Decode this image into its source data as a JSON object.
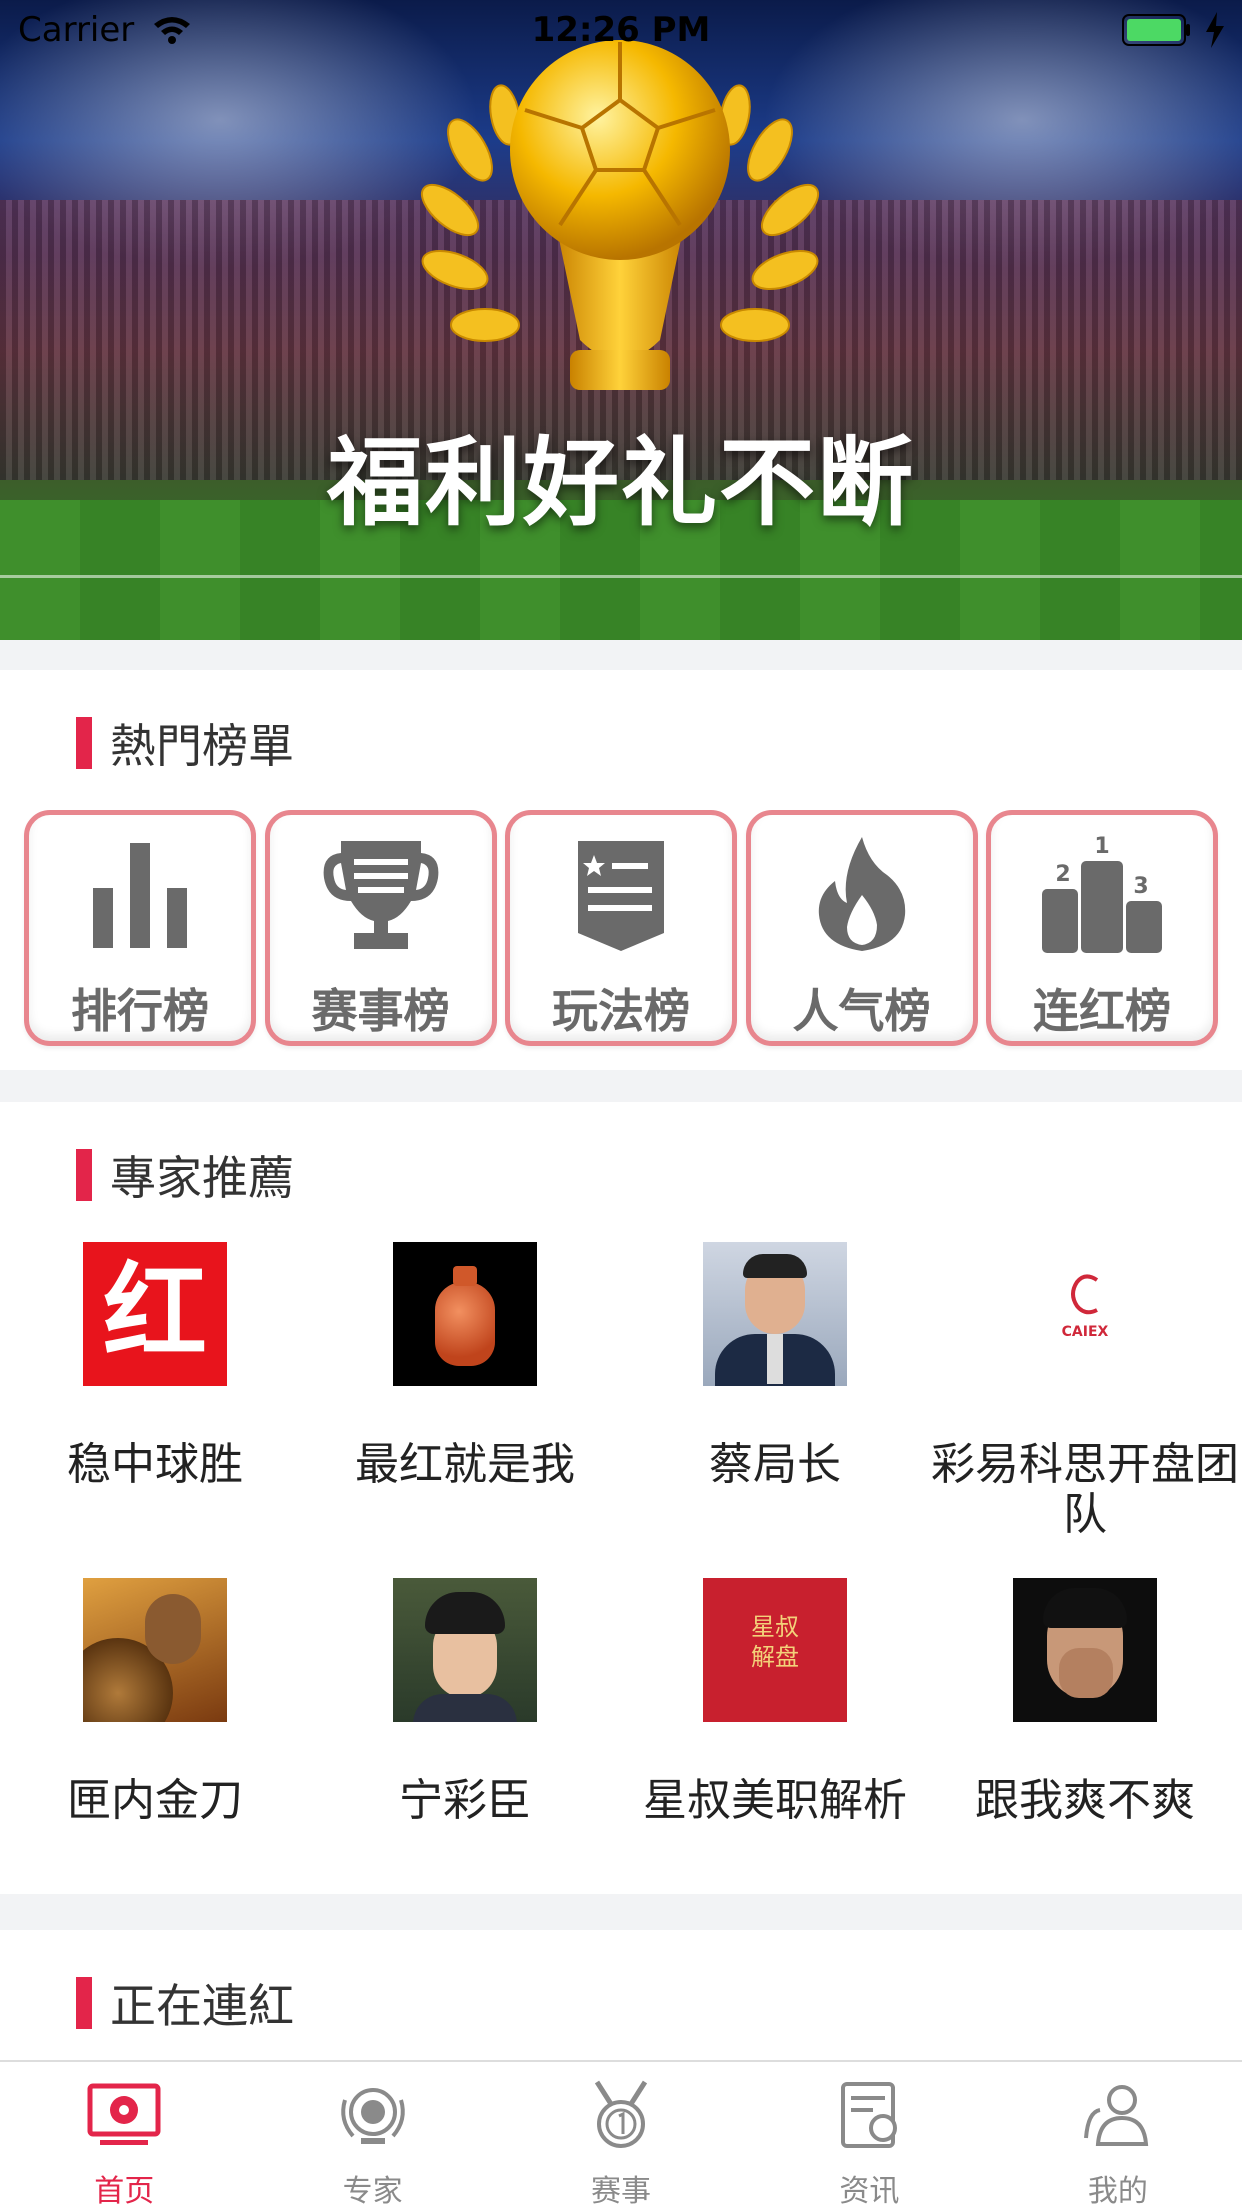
{
  "status_bar": {
    "carrier": "Carrier",
    "time": "12:26 PM"
  },
  "banner": {
    "title": "福利好礼不断"
  },
  "hot_list": {
    "title": "熱門榜單",
    "items": [
      {
        "label": "排行榜",
        "icon": "bar-chart-icon"
      },
      {
        "label": "赛事榜",
        "icon": "trophy-icon"
      },
      {
        "label": "玩法榜",
        "icon": "document-badge-icon"
      },
      {
        "label": "人气榜",
        "icon": "flame-icon"
      },
      {
        "label": "连红榜",
        "icon": "podium-icon",
        "podium_numbers": [
          "1",
          "2",
          "3"
        ]
      }
    ]
  },
  "experts": {
    "title": "專家推薦",
    "items": [
      {
        "name": "稳中球胜",
        "avatar_text": "红"
      },
      {
        "name": "最红就是我"
      },
      {
        "name": "蔡局长"
      },
      {
        "name": "彩易科思开盘团队",
        "avatar_text": "CAIEX"
      },
      {
        "name": "匣内金刀"
      },
      {
        "name": "宁彩臣"
      },
      {
        "name": "星叔美职解析",
        "avatar_text": "星叔解盘"
      },
      {
        "name": "跟我爽不爽"
      }
    ]
  },
  "streak": {
    "title": "正在連紅"
  },
  "tabbar": {
    "active": "首页",
    "items": [
      {
        "label": "首页",
        "icon": "home-tv-icon"
      },
      {
        "label": "专家",
        "icon": "expert-medal-icon"
      },
      {
        "label": "赛事",
        "icon": "match-medal-icon"
      },
      {
        "label": "资讯",
        "icon": "news-icon"
      },
      {
        "label": "我的",
        "icon": "user-icon"
      }
    ]
  },
  "colors": {
    "accent": "#e3254a",
    "card_border": "#e8868e",
    "icon_gray": "#6a6a6a"
  }
}
